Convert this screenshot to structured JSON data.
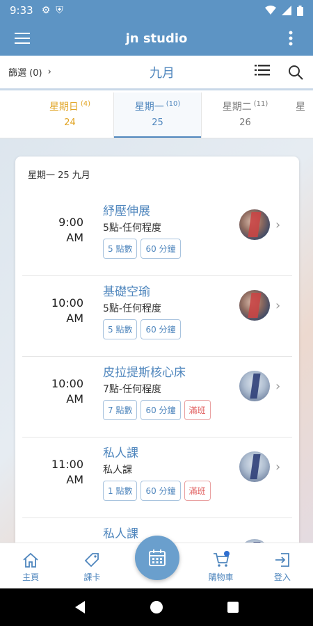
{
  "status": {
    "time": "9:33"
  },
  "appbar": {
    "title": "jn studio"
  },
  "filterbar": {
    "filter_label": "篩選 (0)",
    "month": "九月"
  },
  "days": [
    {
      "name": "星期日",
      "count": "(4)",
      "date": "24"
    },
    {
      "name": "星期一",
      "count": "(10)",
      "date": "25"
    },
    {
      "name": "星期二",
      "count": "(11)",
      "date": "26"
    }
  ],
  "card": {
    "date_header": "星期一 25 九月",
    "classes": [
      {
        "time": "9:00",
        "ampm": "AM",
        "name": "紓壓伸展",
        "sub": "5點-任何程度",
        "tags": [
          "5 點數",
          "60 分鐘"
        ]
      },
      {
        "time": "10:00",
        "ampm": "AM",
        "name": "基礎空瑜",
        "sub": "5點-任何程度",
        "tags": [
          "5 點數",
          "60 分鐘"
        ]
      },
      {
        "time": "10:00",
        "ampm": "AM",
        "name": "皮拉提斯核心床",
        "sub": "7點-任何程度",
        "tags": [
          "7 點數",
          "60 分鐘"
        ],
        "full": "滿班"
      },
      {
        "time": "11:00",
        "ampm": "AM",
        "name": "私人課",
        "sub": "私人課",
        "tags": [
          "1 點數",
          "60 分鐘"
        ],
        "full": "滿班"
      },
      {
        "name": "私人課"
      }
    ]
  },
  "bottomnav": {
    "home": "主頁",
    "card": "課卡",
    "cart": "購物車",
    "login": "登入"
  },
  "colors": {
    "primary": "#5d94c4",
    "accent": "#4f86bd",
    "sunday": "#e1a423",
    "full": "#e05a5a"
  }
}
